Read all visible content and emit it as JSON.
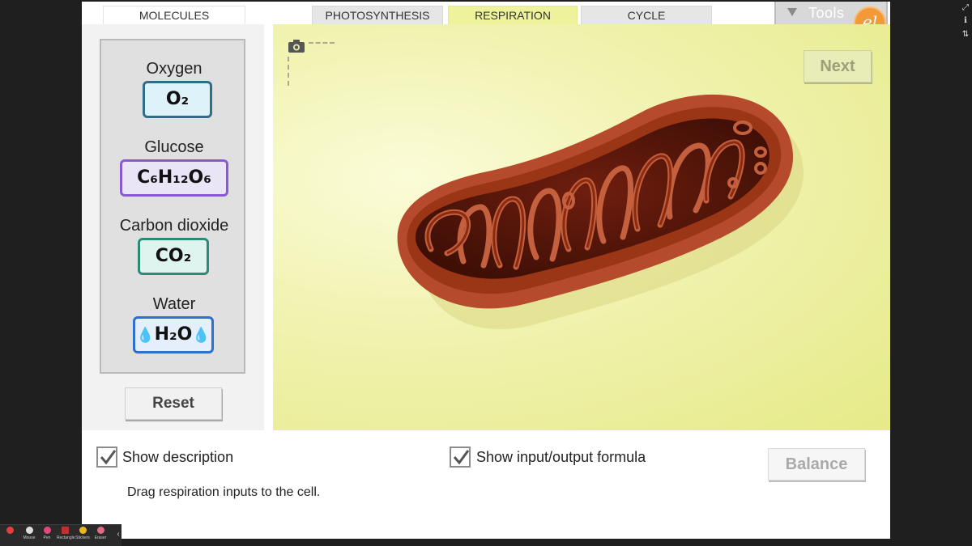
{
  "tabs": {
    "molecules": "MOLECULES",
    "photosynthesis": "PHOTOSYNTHESIS",
    "respiration": "RESPIRATION",
    "cycle": "CYCLE"
  },
  "tools": {
    "label": "Tools",
    "logo_text": "el"
  },
  "molecules": [
    {
      "name": "Oxygen",
      "formula": "O₂"
    },
    {
      "name": "Glucose",
      "formula": "C₆H₁₂O₆"
    },
    {
      "name": "Carbon dioxide",
      "formula": "CO₂"
    },
    {
      "name": "Water",
      "formula": "H₂O"
    }
  ],
  "reset_label": "Reset",
  "next_label": "Next",
  "balance_label": "Balance",
  "show_description": {
    "label": "Show description",
    "checked": true
  },
  "show_formula": {
    "label": "Show input/output formula",
    "checked": true
  },
  "description": "Drag respiration inputs to the cell.",
  "taskbar": [
    "Mouse",
    "Pen",
    "Rectangle",
    "Stickers",
    "Eraser"
  ],
  "colors": {
    "stage_yellow": "#e6ea88",
    "mitochondrion": "#b54a2c",
    "oxygen_border": "#2e6e8a",
    "glucose_border": "#8a5ad3",
    "co2_border": "#2d8a77",
    "water_border": "#2f6fd0"
  }
}
